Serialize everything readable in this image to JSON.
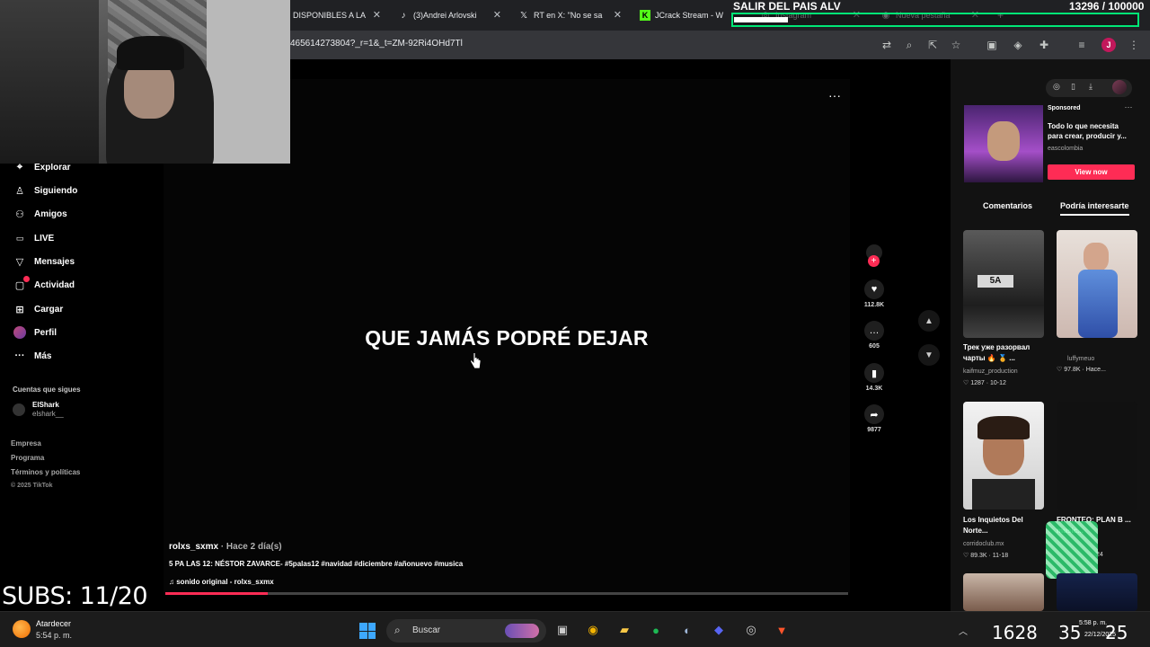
{
  "browser": {
    "tabs": [
      {
        "label": "DISPONIBLES A LA",
        "icon": "generic"
      },
      {
        "label": "(3)Andrei Arlovski",
        "icon": "tiktok"
      },
      {
        "label": "RT en X: \"No se sa",
        "icon": "x"
      },
      {
        "label": "JCrack Stream - W",
        "icon": "kick"
      },
      {
        "label": "Instagram",
        "icon": "instagram"
      },
      {
        "label": "Nueva pestaña",
        "icon": "chrome"
      }
    ],
    "new_tab": "+",
    "url": "465614273804?_r=1&_t=ZM-92Ri4OHd7Tl",
    "profile_letter": "J"
  },
  "stream": {
    "overlay_title": "SALIR DEL PAIS ALV",
    "goal_count": "13296 / 100000",
    "goal_fraction": 0.133,
    "subs": "SUBS: 11/20"
  },
  "sidebar": {
    "items": [
      {
        "label": "Explorar",
        "icon": "compass-icon"
      },
      {
        "label": "Siguiendo",
        "icon": "user-icon"
      },
      {
        "label": "Amigos",
        "icon": "users-icon"
      },
      {
        "label": "LIVE",
        "icon": "live-icon"
      },
      {
        "label": "Mensajes",
        "icon": "send-icon"
      },
      {
        "label": "Actividad",
        "icon": "activity-icon"
      },
      {
        "label": "Cargar",
        "icon": "upload-icon"
      },
      {
        "label": "Perfil",
        "icon": "avatar"
      },
      {
        "label": "Más",
        "icon": "more-icon"
      }
    ],
    "following_title": "Cuentas que sigues",
    "following": [
      {
        "name": "ElShark",
        "handle": "elshark__"
      }
    ],
    "footer": [
      "Empresa",
      "Programa",
      "Términos y políticas",
      "© 2025 TikTok"
    ]
  },
  "video": {
    "lyric": "QUE JAMÁS PODRÉ DEJAR",
    "author": "rolxs_sxmx",
    "posted": "· Hace 2 día(s)",
    "description": "5 PA LAS 12: NÉSTOR ZAVARCE- #5palas12 #navidad #diciembre #añonuevo #musica",
    "sound": "sonido original - rolxs_sxmx",
    "progress_fraction": 0.15,
    "actions": [
      {
        "name": "like",
        "icon": "heart-icon",
        "count": "112.8K"
      },
      {
        "name": "comment",
        "icon": "comment-icon",
        "count": "605"
      },
      {
        "name": "save",
        "icon": "bookmark-icon",
        "count": "14.3K"
      },
      {
        "name": "share",
        "icon": "share-icon",
        "count": "9877"
      }
    ]
  },
  "rail": {
    "ad": {
      "sponsored": "Sponsored",
      "text": "Todo lo que necesita para crear, producir y...",
      "domain": "eascolombia",
      "cta": "View now"
    },
    "tabs": [
      "Comentarios",
      "Podría interesarte"
    ],
    "cards": [
      {
        "title": "Трек уже разорвал чарты 🔥 🏅 ...",
        "user": "kaifmuz_production",
        "stats": "♡ 1287 · 10-12"
      },
      {
        "title": "",
        "user": "luffymeuo",
        "stats": "♡ 97.8K · Hace..."
      },
      {
        "title": "Los Inquietos Del Norte...",
        "user": "corridoclub.mx",
        "stats": "♡ 89.3K · 11-18"
      },
      {
        "title": "FRONTEO: PLAN B ... music...",
        "user": "",
        "stats": "24"
      }
    ]
  },
  "taskbar": {
    "weather_label": "Atardecer",
    "weather_time": "5:54 p. m.",
    "search_label": "Buscar",
    "tray_value_1": "1628",
    "tray_value_2": "35",
    "tray_value_3": "25",
    "clock": "5:58 p. m.",
    "date": "22/12/2025"
  },
  "colors": {
    "accent": "#fe2c55",
    "goal_border": "#00e676",
    "taskbar": "#1c1c1c"
  }
}
